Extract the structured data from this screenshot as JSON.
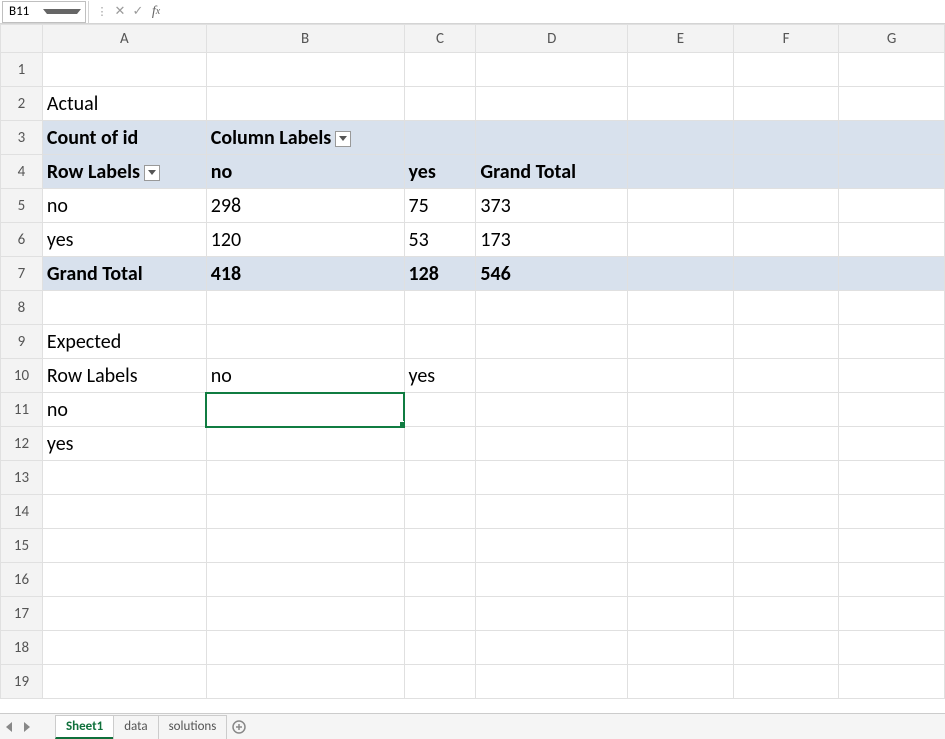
{
  "nameBox": "B11",
  "formula": "",
  "cols": [
    "A",
    "B",
    "C",
    "D",
    "E",
    "F",
    "G"
  ],
  "rows": [
    "1",
    "2",
    "3",
    "4",
    "5",
    "6",
    "7",
    "8",
    "9",
    "10",
    "11",
    "12",
    "13",
    "14",
    "15",
    "16",
    "17",
    "18",
    "19"
  ],
  "cells": {
    "A2": "Actual",
    "A3": "Count of id",
    "B3": "Column Labels",
    "A4": "Row Labels",
    "B4": "no",
    "C4": "yes",
    "D4": "Grand Total",
    "A5": "no",
    "B5": "298",
    "C5": "75",
    "D5": "373",
    "A6": "yes",
    "B6": "120",
    "C6": "53",
    "D6": "173",
    "A7": "Grand Total",
    "B7": "418",
    "C7": "128",
    "D7": "546",
    "A9": "Expected",
    "A10": "Row Labels",
    "B10": "no",
    "C10": "yes",
    "A11": "no",
    "A12": "yes"
  },
  "tabs": [
    "Sheet1",
    "data",
    "solutions"
  ],
  "activeTab": "Sheet1"
}
